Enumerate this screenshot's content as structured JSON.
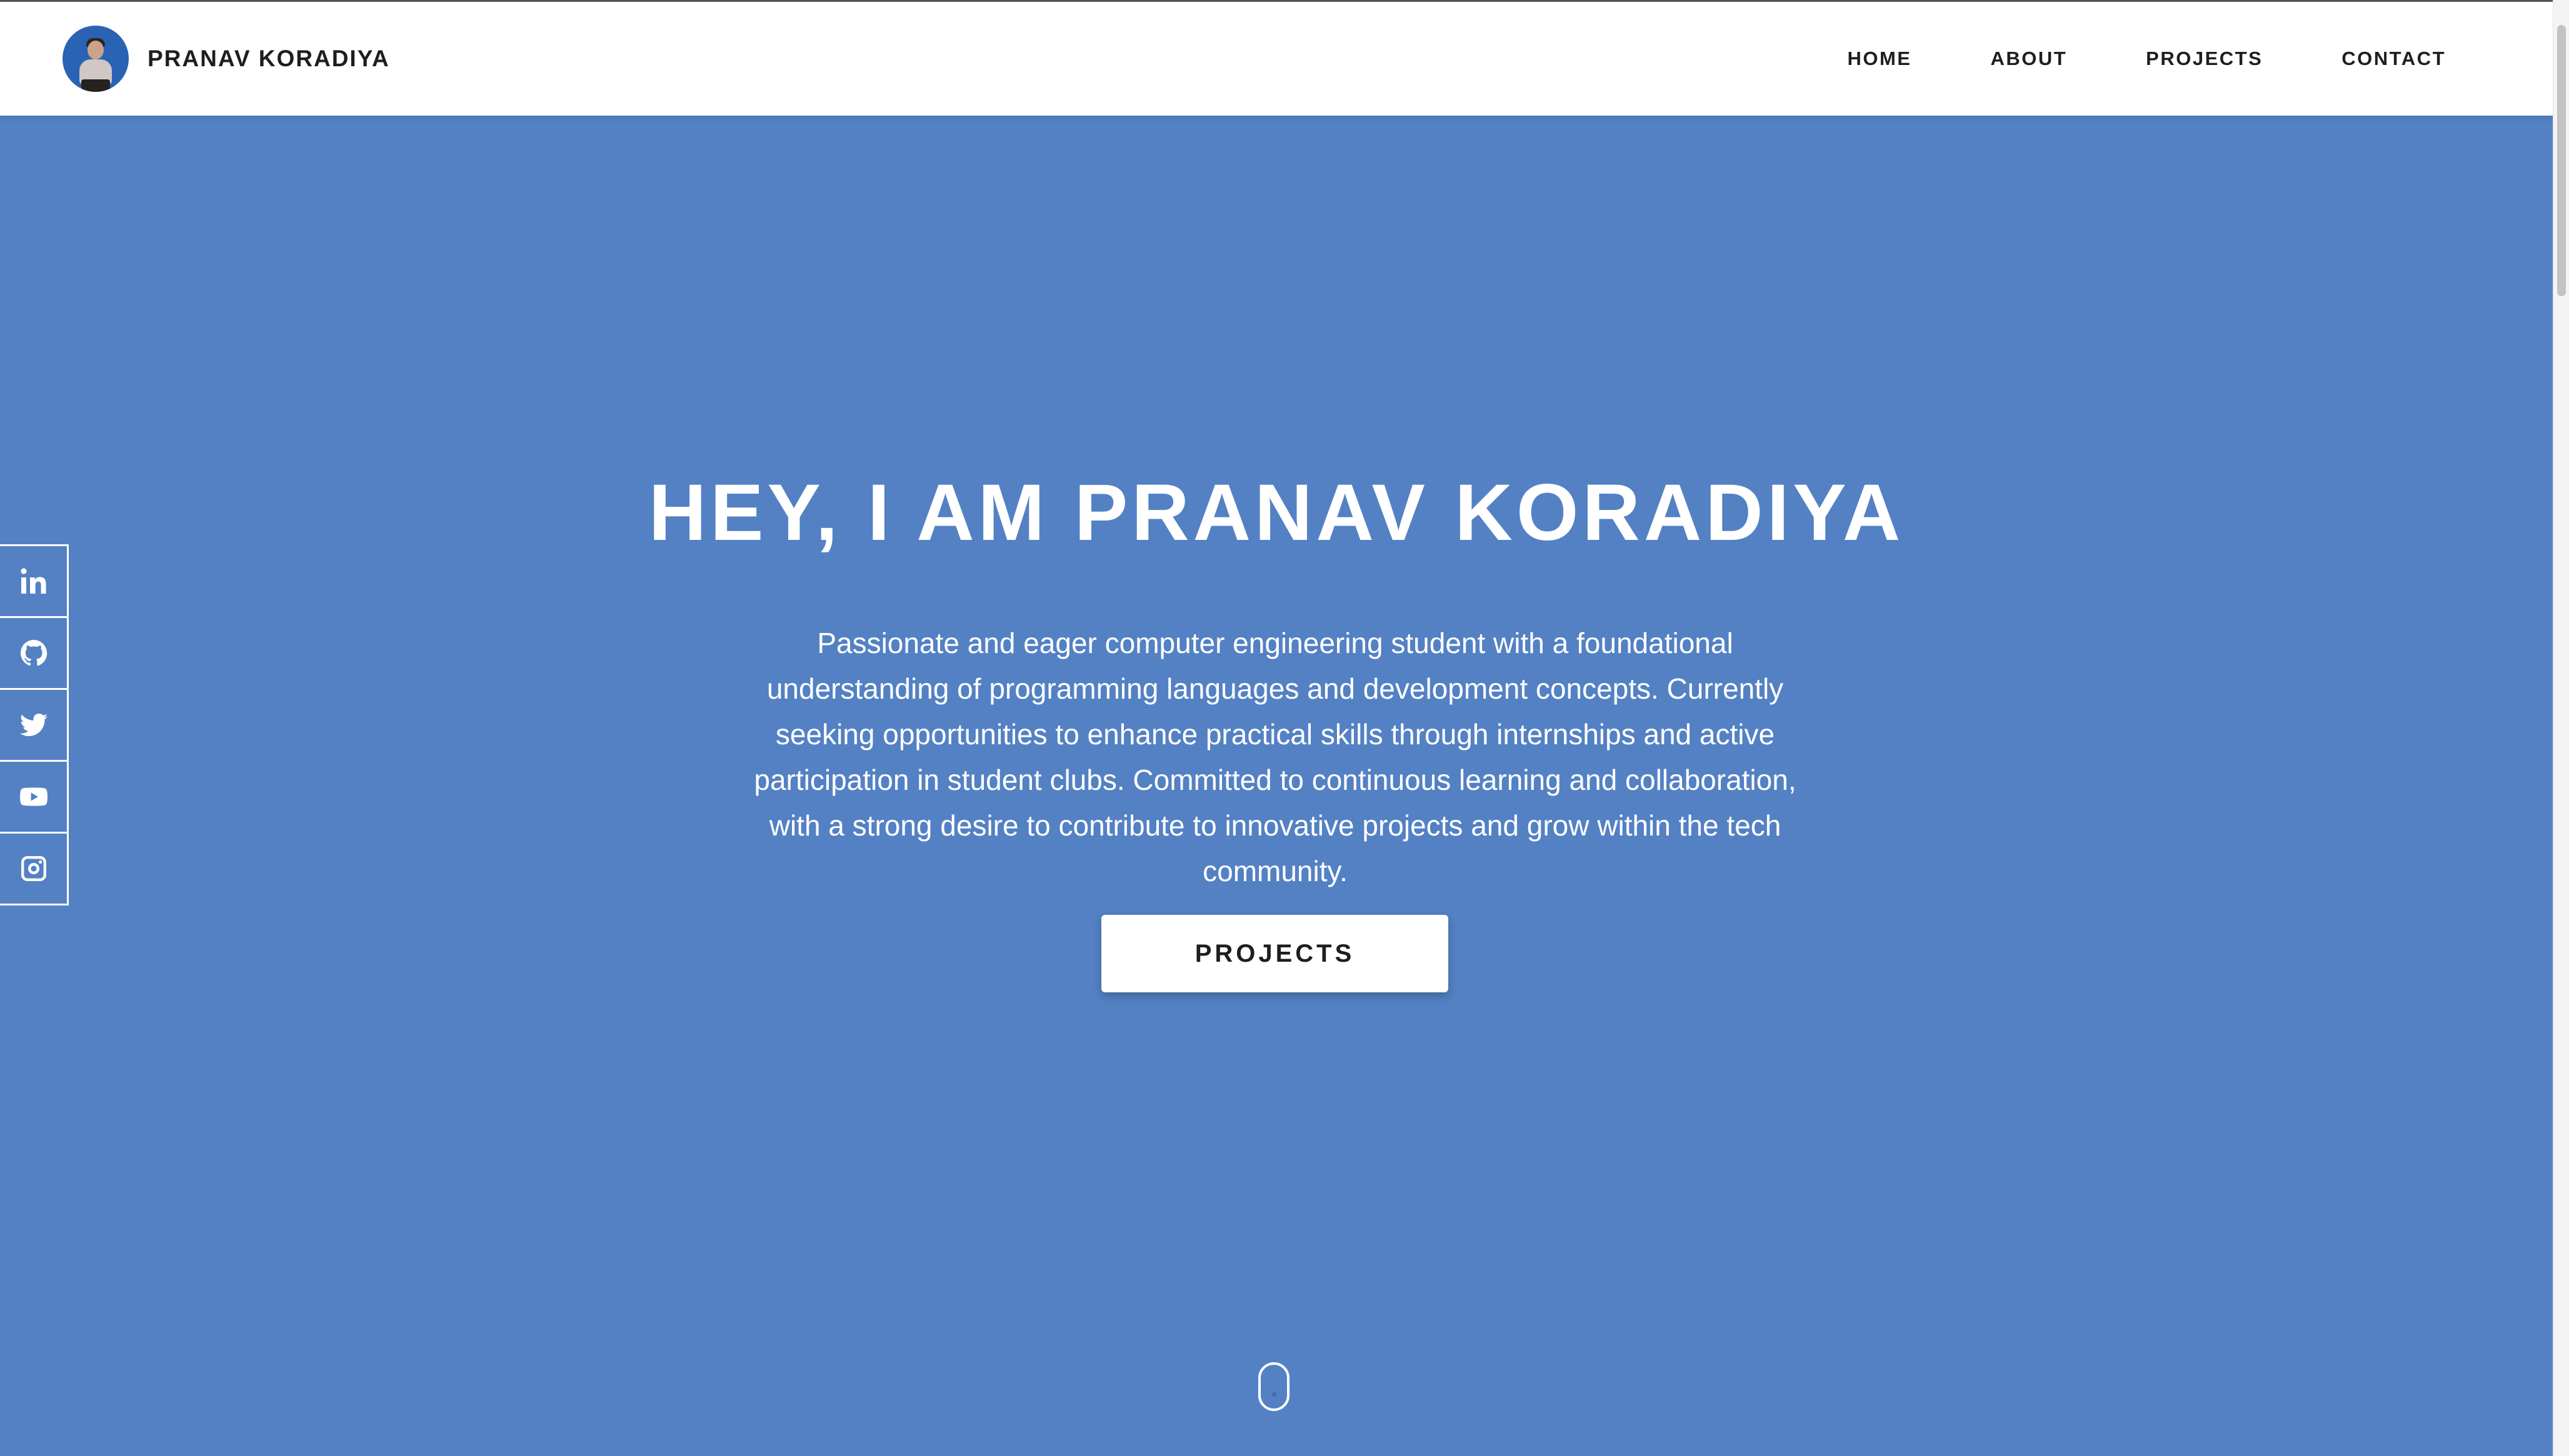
{
  "header": {
    "brand_name": "PRANAV KORADIYA",
    "avatar_icon": "profile-photo",
    "nav": [
      {
        "label": "HOME"
      },
      {
        "label": "ABOUT"
      },
      {
        "label": "PROJECTS"
      },
      {
        "label": "CONTACT"
      }
    ]
  },
  "social": [
    {
      "icon": "linkedin-icon"
    },
    {
      "icon": "github-icon"
    },
    {
      "icon": "twitter-icon"
    },
    {
      "icon": "youtube-icon"
    },
    {
      "icon": "instagram-icon"
    }
  ],
  "hero": {
    "title": "HEY, I AM PRANAV KORADIYA",
    "description": "Passionate and eager computer engineering student with a foundational understanding of programming languages and development concepts. Currently seeking opportunities to enhance practical skills through internships and active participation in student clubs. Committed to continuous learning and collaboration, with a strong desire to contribute to innovative projects and grow within the tech community.",
    "cta_label": "PROJECTS",
    "scroll_indicator_icon": "mouse-scroll-icon"
  },
  "colors": {
    "hero_background": "#5381c4",
    "header_background": "#ffffff",
    "text_dark": "#1e1e1e",
    "text_light": "#ffffff"
  }
}
